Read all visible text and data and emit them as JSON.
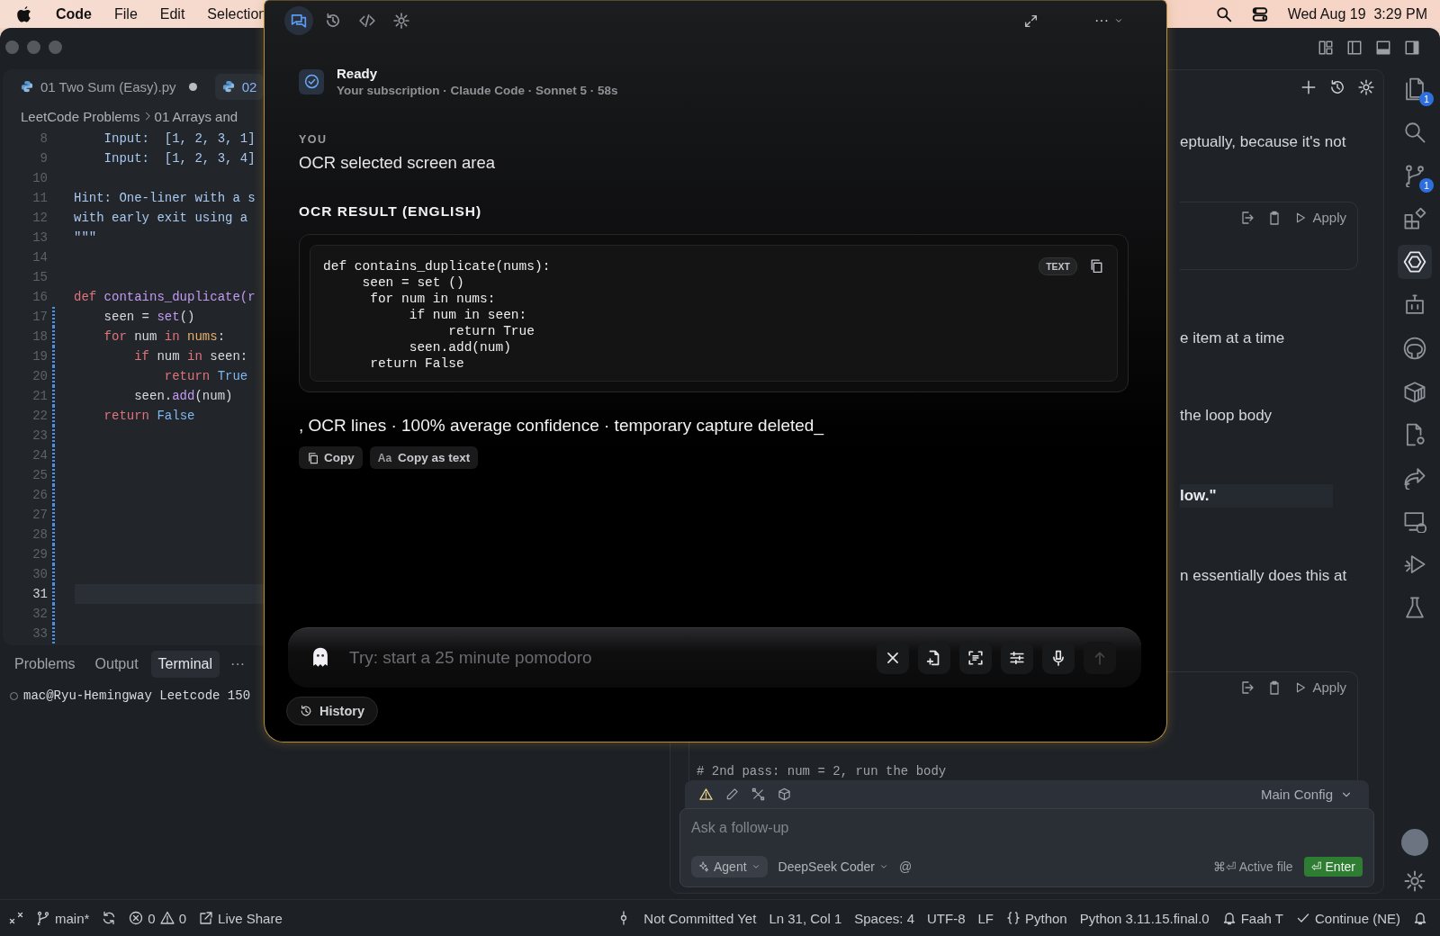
{
  "menubar": {
    "app": "Code",
    "menus": [
      "File",
      "Edit",
      "Selection"
    ],
    "clock": "Wed Aug 19  3:29 PM"
  },
  "editor": {
    "tabs": [
      {
        "label": "01 Two Sum (Easy).py",
        "selected": false,
        "modified": true
      },
      {
        "label": "02",
        "selected": true,
        "modified": false
      }
    ],
    "breadcrumb": [
      "LeetCode Problems",
      "01 Arrays and"
    ],
    "lines": [
      {
        "number": "8",
        "changed": false,
        "current": false,
        "tokens": [
          {
            "t": "    Input:  [1, 2, 3, 1]",
            "kind": "doc"
          }
        ]
      },
      {
        "number": "9",
        "changed": false,
        "current": false,
        "tokens": [
          {
            "t": "    Input:  [1, 2, 3, 4]",
            "kind": "doc"
          }
        ]
      },
      {
        "number": "10",
        "changed": false,
        "current": false
      },
      {
        "number": "11",
        "changed": false,
        "current": false,
        "tokens": [
          {
            "t": "Hint: One-liner with a s",
            "kind": "doc"
          }
        ]
      },
      {
        "number": "12",
        "changed": false,
        "current": false,
        "tokens": [
          {
            "t": "with early exit using a",
            "kind": "doc"
          }
        ]
      },
      {
        "number": "13",
        "changed": false,
        "current": false,
        "tokens": [
          {
            "t": "\"\"\"",
            "kind": "doc"
          }
        ]
      },
      {
        "number": "14",
        "changed": false,
        "current": false
      },
      {
        "number": "15",
        "changed": false,
        "current": false
      },
      {
        "number": "16",
        "changed": false,
        "current": false,
        "tokens": [
          {
            "t": "def ",
            "kind": "keyword"
          },
          {
            "t": "contains_duplicate(r",
            "kind": "func"
          }
        ]
      },
      {
        "number": "17",
        "changed": true,
        "current": false,
        "tokens": [
          {
            "t": "    seen = ",
            "kind": "plain"
          },
          {
            "t": "set",
            "kind": "func"
          },
          {
            "t": "()",
            "kind": "plain"
          }
        ]
      },
      {
        "number": "18",
        "changed": true,
        "current": false,
        "tokens": [
          {
            "t": "    for ",
            "kind": "keyword"
          },
          {
            "t": "num ",
            "kind": "plain"
          },
          {
            "t": "in ",
            "kind": "keyword"
          },
          {
            "t": "nums",
            "kind": "param"
          },
          {
            "t": ":",
            "kind": "plain"
          }
        ]
      },
      {
        "number": "19",
        "changed": true,
        "current": false,
        "tokens": [
          {
            "t": "        if ",
            "kind": "keyword"
          },
          {
            "t": "num ",
            "kind": "plain"
          },
          {
            "t": "in ",
            "kind": "keyword"
          },
          {
            "t": "seen:",
            "kind": "plain"
          }
        ]
      },
      {
        "number": "20",
        "changed": true,
        "current": false,
        "tokens": [
          {
            "t": "            return ",
            "kind": "keyword"
          },
          {
            "t": "True",
            "kind": "const"
          }
        ]
      },
      {
        "number": "21",
        "changed": true,
        "current": false,
        "tokens": [
          {
            "t": "        seen.",
            "kind": "plain"
          },
          {
            "t": "add",
            "kind": "func"
          },
          {
            "t": "(num)",
            "kind": "plain"
          }
        ]
      },
      {
        "number": "22",
        "changed": true,
        "current": false,
        "tokens": [
          {
            "t": "    return ",
            "kind": "keyword"
          },
          {
            "t": "False",
            "kind": "const"
          }
        ]
      },
      {
        "number": "23",
        "changed": true,
        "current": false
      },
      {
        "number": "24",
        "changed": true,
        "current": false
      },
      {
        "number": "25",
        "changed": true,
        "current": false
      },
      {
        "number": "26",
        "changed": true,
        "current": false
      },
      {
        "number": "27",
        "changed": true,
        "current": false
      },
      {
        "number": "28",
        "changed": true,
        "current": false
      },
      {
        "number": "29",
        "changed": true,
        "current": false
      },
      {
        "number": "30",
        "changed": true,
        "current": false
      },
      {
        "number": "31",
        "changed": true,
        "current": true
      },
      {
        "number": "32",
        "changed": true,
        "current": false
      },
      {
        "number": "33",
        "changed": true,
        "current": false
      }
    ]
  },
  "panel": {
    "tabs": [
      {
        "label": "Problems",
        "selected": false
      },
      {
        "label": "Output",
        "selected": false
      },
      {
        "label": "Terminal",
        "selected": true
      }
    ],
    "more": "···",
    "terminal_line": "mac@Ryu-Hemingway Leetcode 150"
  },
  "chat": {
    "snippets": [
      {
        "kind": "text",
        "text": "eptually, because it's not"
      },
      {
        "kind": "code",
        "apply": "Apply"
      },
      {
        "kind": "text",
        "text": "e item at a time"
      },
      {
        "kind": "text",
        "text": "the loop body"
      },
      {
        "kind": "quote",
        "text": "low.\""
      },
      {
        "kind": "text",
        "text": "n essentially does this at"
      }
    ],
    "last_block": {
      "apply": "Apply",
      "code": "# 2nd pass: num = 2, run the body"
    },
    "config": "Main Config",
    "input": {
      "placeholder": "Ask a follow-up",
      "mode": "Agent",
      "model": "DeepSeek Coder",
      "mention": "@",
      "hint": "⌘⏎ Active file",
      "send": "⏎ Enter"
    }
  },
  "activity_bar": [
    {
      "kind": "files",
      "badge": "1",
      "selected": false
    },
    {
      "kind": "search",
      "selected": false
    },
    {
      "kind": "branch",
      "badge": "1",
      "selected": false
    },
    {
      "kind": "extensions",
      "selected": false
    },
    {
      "kind": "hexagon",
      "selected": true
    },
    {
      "kind": "robot",
      "selected": false
    },
    {
      "kind": "github",
      "selected": false
    },
    {
      "kind": "box",
      "selected": false
    },
    {
      "kind": "filegear",
      "selected": false
    },
    {
      "kind": "share",
      "selected": false
    },
    {
      "kind": "remote",
      "selected": false
    },
    {
      "kind": "debug",
      "selected": false
    },
    {
      "kind": "flask",
      "selected": false
    }
  ],
  "status_bar": {
    "branch": "main*",
    "errors": "0",
    "warnings": "0",
    "live_share": "Live Share",
    "items": [
      "Not Committed Yet",
      "Ln 31, Col 1",
      "Spaces: 4",
      "UTF-8",
      "LF"
    ],
    "language": "Python",
    "interpreter": "Python 3.11.15.final.0",
    "user": "Faah T",
    "continue": "Continue (NE)"
  },
  "overlay": {
    "tabs": [
      {
        "kind": "chat",
        "selected": true
      },
      {
        "kind": "history",
        "selected": false
      },
      {
        "kind": "code",
        "selected": false
      },
      {
        "kind": "settings",
        "selected": false
      }
    ],
    "more": "···",
    "status": {
      "title": "Ready",
      "subtitle": "Your subscription · Claude Code · Sonnet 5 · 58s"
    },
    "message": {
      "role": "YOU",
      "text": "OCR selected screen area"
    },
    "result_heading": "OCR RESULT (ENGLISH)",
    "code": "def contains_duplicate(nums):\n     seen = set ()\n      for num in nums:\n           if num in seen:\n                return True\n           seen.add(num)\n      return False",
    "code_badge": "TEXT",
    "summary": ", OCR lines · 100% average confidence · temporary capture deleted_",
    "actions": [
      {
        "kind": "copy",
        "label": "Copy"
      },
      {
        "kind": "text",
        "label": "Copy as text",
        "prefix": "Aa"
      }
    ],
    "input": {
      "placeholder": "Try: start a 25 minute pomodoro",
      "buttons": [
        {
          "kind": "close",
          "disabled": false
        },
        {
          "kind": "attach",
          "disabled": false
        },
        {
          "kind": "scan",
          "disabled": false
        },
        {
          "kind": "sliders",
          "disabled": false
        },
        {
          "kind": "mic",
          "disabled": false
        },
        {
          "kind": "send",
          "disabled": true
        }
      ]
    },
    "history": "History"
  }
}
